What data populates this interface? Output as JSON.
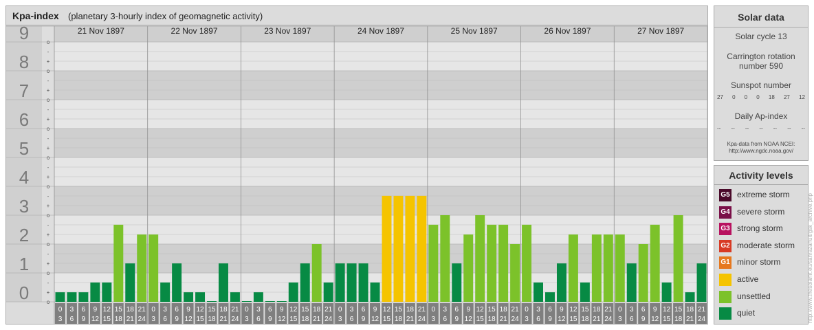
{
  "header": {
    "title": "Kpa-index",
    "subtitle": "(planetary 3-hourly index of geomagnetic activity)"
  },
  "solar": {
    "title": "Solar data",
    "cycle": "Solar cycle 13",
    "carrington_line1": "Carrington rotation",
    "carrington_line2": "number 590",
    "sunspot_label": "Sunspot number",
    "sunspot_values": [
      "27",
      "0",
      "0",
      "0",
      "18",
      "27",
      "12"
    ],
    "ap_label": "Daily Ap-index",
    "ap_values": [
      "--",
      "--",
      "--",
      "--",
      "--",
      "--",
      "--"
    ],
    "source_line1": "Kpa-data from NOAA NCEI:",
    "source_line2": "http://www.ngdc.noaa.gov/"
  },
  "levels": {
    "title": "Activity levels",
    "items": [
      {
        "badge": "G5",
        "label": "extreme storm",
        "color": "#4a0a2a"
      },
      {
        "badge": "G4",
        "label": "severe storm",
        "color": "#7a1048"
      },
      {
        "badge": "G3",
        "label": "strong storm",
        "color": "#b8125f"
      },
      {
        "badge": "G2",
        "label": "moderate storm",
        "color": "#d83a24"
      },
      {
        "badge": "G1",
        "label": "minor storm",
        "color": "#e6781e"
      },
      {
        "badge": "",
        "label": "active",
        "color": "#f5c400"
      },
      {
        "badge": "",
        "label": "unsettled",
        "color": "#7cc22a"
      },
      {
        "badge": "",
        "label": "quiet",
        "color": "#078a44"
      }
    ]
  },
  "credit": "http://www.thesolarfit.eu/sanrazanuit/gsk_archive.php",
  "chart_data": {
    "type": "bar",
    "ylim": [
      0,
      9
    ],
    "y_ticks": [
      "0",
      "1",
      "2",
      "3",
      "4",
      "5",
      "6",
      "7",
      "8",
      "9"
    ],
    "sub_ticks": [
      "o",
      "+",
      "-"
    ],
    "days": [
      "21 Nov 1897",
      "22 Nov 1897",
      "23 Nov 1897",
      "24 Nov 1897",
      "25 Nov 1897",
      "26 Nov 1897",
      "27 Nov 1897"
    ],
    "interval_starts": [
      "0",
      "3",
      "6",
      "9",
      "12",
      "15",
      "18",
      "21"
    ],
    "interval_ends": [
      "3",
      "6",
      "9",
      "12",
      "15",
      "18",
      "21",
      "24"
    ],
    "values": [
      [
        0.33,
        0.33,
        0.33,
        0.67,
        0.67,
        2.67,
        1.33,
        2.33
      ],
      [
        2.33,
        0.67,
        1.33,
        0.33,
        0.33,
        0.0,
        1.33,
        0.33
      ],
      [
        0.0,
        0.33,
        0.0,
        0.0,
        0.67,
        1.33,
        2.0,
        0.67
      ],
      [
        1.33,
        1.33,
        1.33,
        0.67,
        3.67,
        3.67,
        3.67,
        3.67
      ],
      [
        2.67,
        3.0,
        1.33,
        2.33,
        3.0,
        2.67,
        2.67,
        2.0
      ],
      [
        2.67,
        0.67,
        0.33,
        1.33,
        2.33,
        0.67,
        2.33,
        2.33
      ],
      [
        2.33,
        1.33,
        2.0,
        2.67,
        0.67,
        3.0,
        0.33,
        1.33
      ]
    ],
    "colors": {
      "quiet": "#078a44",
      "unsettled": "#7cc22a",
      "active": "#f5c400"
    }
  }
}
